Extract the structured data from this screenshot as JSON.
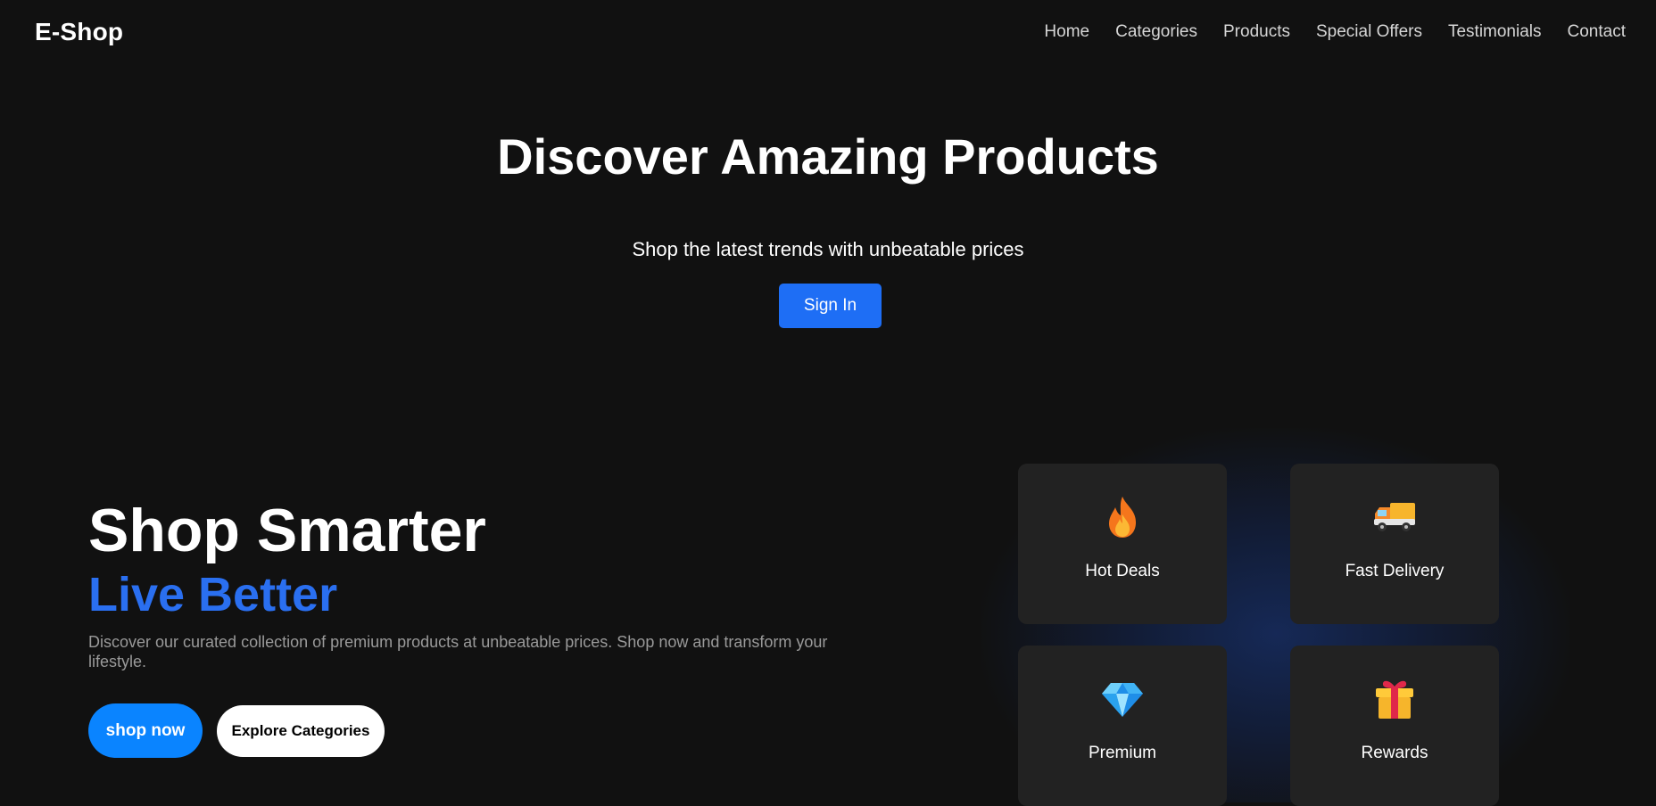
{
  "navbar": {
    "brand": "E-Shop",
    "links": [
      "Home",
      "Categories",
      "Products",
      "Special Offers",
      "Testimonials",
      "Contact"
    ]
  },
  "hero": {
    "title": "Discover Amazing Products",
    "subtitle": "Shop the latest trends with unbeatable prices",
    "signin_label": "Sign In"
  },
  "promo": {
    "title": "Shop Smarter",
    "tagline": "Live Better",
    "description": "Discover our curated collection of premium products at unbeatable prices. Shop now and transform your lifestyle.",
    "shop_label": "shop now",
    "explore_label": "Explore Categories"
  },
  "features": [
    {
      "label": "Hot Deals",
      "icon": "fire-icon"
    },
    {
      "label": "Fast Delivery",
      "icon": "delivery-truck-icon"
    },
    {
      "label": "Premium",
      "icon": "diamond-icon"
    },
    {
      "label": "Rewards",
      "icon": "gift-icon"
    }
  ],
  "colors": {
    "background": "#111111",
    "accent_blue": "#1e6ef5",
    "tagline_blue": "#2a6ff0",
    "shop_button": "#0a84ff",
    "card": "#222222"
  }
}
